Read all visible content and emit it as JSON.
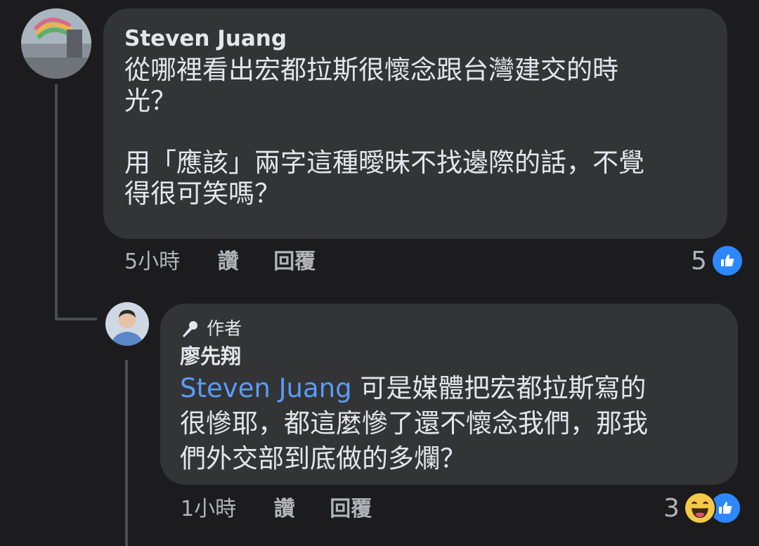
{
  "comment": {
    "author": "Steven Juang",
    "text_line1": "從哪裡看出宏都拉斯很懷念跟台灣建交的時",
    "text_line2": "光？",
    "text_line3": "用「應該」兩字這種曖昧不找邊際的話，不覺",
    "text_line4": "得很可笑嗎？",
    "time": "5小時",
    "like_label": "讚",
    "reply_label": "回覆",
    "reaction_count": "5"
  },
  "reply": {
    "badge": "作者",
    "author": "廖先翔",
    "mention": "Steven Juang",
    "text_line1": " 可是媒體把宏都拉斯寫的",
    "text_line2": "很慘耶，都這麼慘了還不懷念我們，那我",
    "text_line3": "們外交部到底做的多爛？",
    "time": "1小時",
    "like_label": "讚",
    "reply_label": "回覆",
    "reaction_count": "3"
  },
  "colors": {
    "background": "#1c1c1e",
    "bubble": "#333436",
    "mention": "#5b9bf8",
    "like": "#2d88ff",
    "haha": "#f7c948"
  },
  "icons": [
    "like-icon",
    "haha-icon",
    "microphone-icon"
  ]
}
